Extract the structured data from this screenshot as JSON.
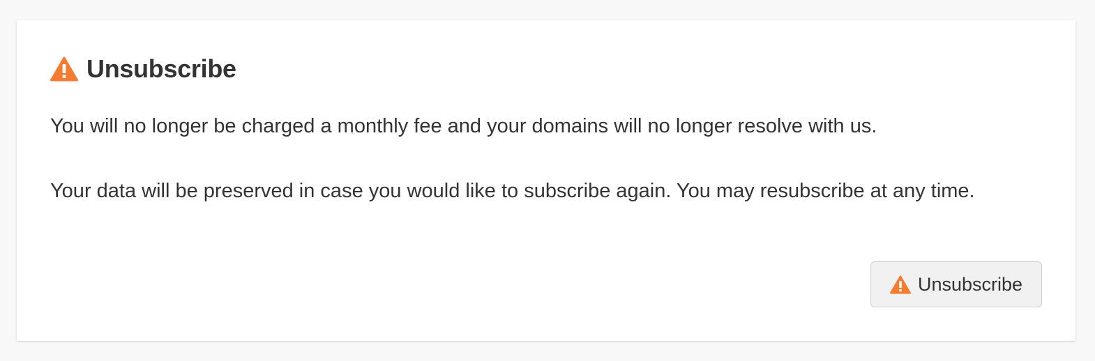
{
  "colors": {
    "warning": "#f47b30",
    "text": "#333333",
    "background": "#f8f8f8",
    "card": "#ffffff",
    "button_bg": "#f1f1f1"
  },
  "card": {
    "title": "Unsubscribe",
    "title_icon": "warning-icon",
    "paragraphs": [
      "You will no longer be charged a monthly fee and your domains will no longer resolve with us.",
      "Your data will be preserved in case you would like to subscribe again. You may resubscribe at any time."
    ],
    "button": {
      "icon": "warning-icon",
      "label": "Unsubscribe"
    }
  }
}
